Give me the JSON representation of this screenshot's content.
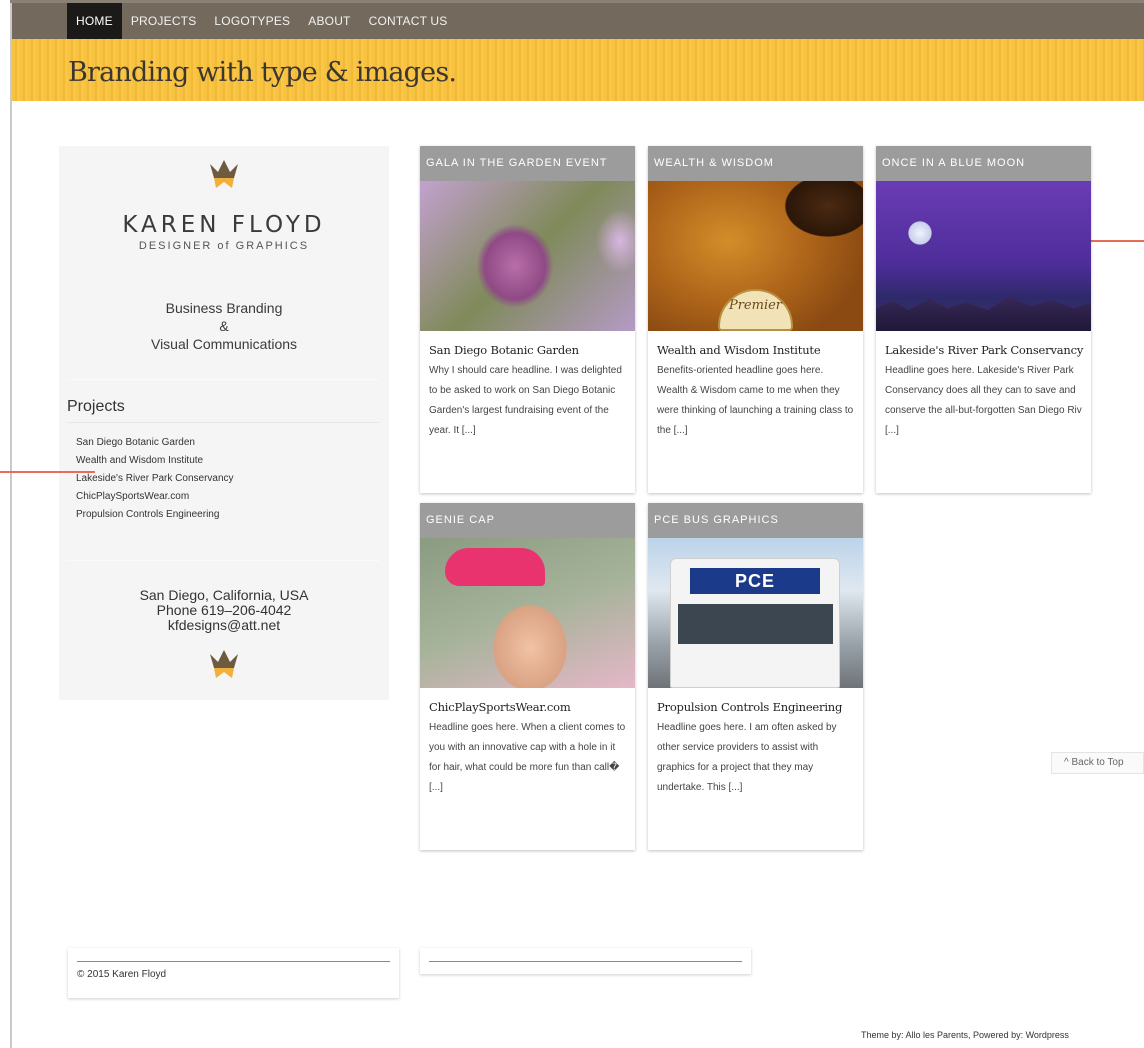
{
  "nav": {
    "items": [
      "HOME",
      "PROJECTS",
      "LOGOTYPES",
      "ABOUT",
      "CONTACT US"
    ]
  },
  "banner": {
    "title": "Branding with type & images."
  },
  "sidebar": {
    "brand_name": "KAREN FLOYD",
    "brand_sub": "DESIGNER of GRAPHICS",
    "services_line1": "Business Branding",
    "services_line2": "&",
    "services_line3": "Visual Communications",
    "projects_heading": "Projects",
    "projects": [
      "San Diego Botanic Garden",
      "Wealth and Wisdom Institute",
      "Lakeside's River Park Conservancy",
      "ChicPlaySportsWear.com",
      "Propulsion Controls Engineering"
    ],
    "contact_line1": "San Diego, California, USA",
    "contact_line2": "Phone 619–206-4042",
    "contact_line3": "kfdesigns@att.net"
  },
  "cards": [
    {
      "category": "GALA IN THE GARDEN EVENT",
      "title": "San Diego Botanic Garden",
      "excerpt": "Why I should care headline. I was delighted to be asked to work on San Diego Botanic Garden's largest fundraising event of the year. It [...]"
    },
    {
      "category": "WEALTH & WISDOM",
      "title": "Wealth and Wisdom Institute",
      "excerpt": "Benefits-oriented headline goes here. Wealth & Wisdom came to me when they were thinking of launching a training class to the [...]",
      "badge_text": "Premier"
    },
    {
      "category": "ONCE IN A BLUE MOON",
      "title": "Lakeside's River Park Conservancy",
      "excerpt": "Headline goes here. Lakeside's River Park Conservancy does all they can to save and conserve the all-but-forgotten San Diego Riv [...]"
    },
    {
      "category": "GENIE CAP",
      "title": "ChicPlaySportsWear.com",
      "excerpt": "Headline goes here. When a client comes to you with an innovative cap with a hole in it for hair, what could be more fun than call� [...]"
    },
    {
      "category": "PCE BUS GRAPHICS",
      "title": "Propulsion Controls Engineering",
      "excerpt": "Headline goes here. I am often asked by other service providers to assist with graphics for a project that they may undertake. This [...]",
      "sign_text": "PCE"
    }
  ],
  "back_to_top": "^ Back to Top",
  "footer": {
    "copyright": "© 2015 Karen Floyd",
    "theme_credit": "Theme by: Allo les Parents, Powered by: Wordpress"
  },
  "colors": {
    "nav_bg": "#736a5d",
    "nav_active": "#1c1a18",
    "banner": "#f7c23f",
    "card_head": "#9c9c9c",
    "marker": "#e56e58"
  }
}
